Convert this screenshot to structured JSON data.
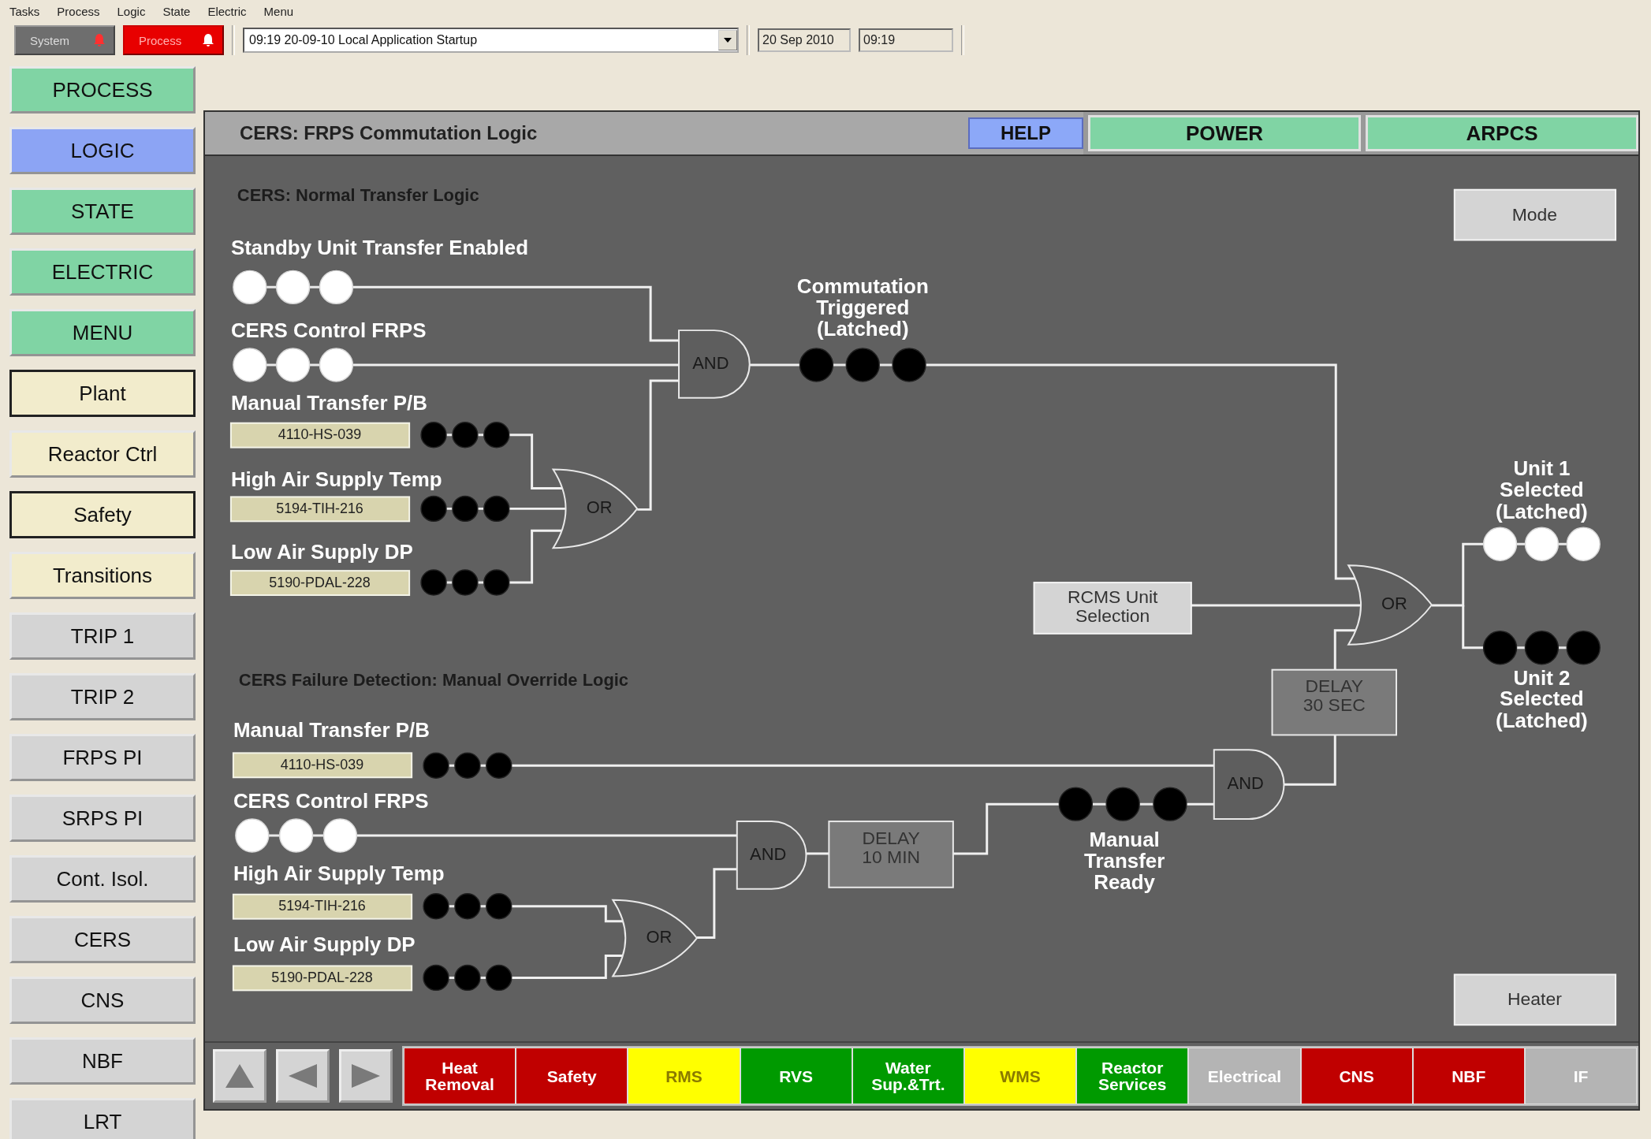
{
  "menu_bar": [
    "Tasks",
    "Process",
    "Logic",
    "State",
    "Electric",
    "Menu"
  ],
  "toolbar": {
    "alarm_buttons": [
      {
        "label": "System",
        "active": false
      },
      {
        "label": "Process",
        "active": true
      }
    ],
    "event_log": "09:19 20-09-10 Local Application Startup",
    "date": "20 Sep 2010",
    "time": "09:19"
  },
  "sidebar": [
    {
      "label": "PROCESS",
      "kind": "view",
      "selected": false
    },
    {
      "label": "LOGIC",
      "kind": "view",
      "selected": true
    },
    {
      "label": "STATE",
      "kind": "view",
      "selected": false
    },
    {
      "label": "ELECTRIC",
      "kind": "view",
      "selected": false
    },
    {
      "label": "MENU",
      "kind": "view",
      "selected": false
    },
    {
      "label": "Plant",
      "kind": "area",
      "selected": true
    },
    {
      "label": "Reactor Ctrl",
      "kind": "area",
      "selected": false
    },
    {
      "label": "Safety",
      "kind": "area",
      "selected": true
    },
    {
      "label": "Transitions",
      "kind": "area",
      "selected": false
    },
    {
      "label": "TRIP 1",
      "kind": "system",
      "selected": false
    },
    {
      "label": "TRIP 2",
      "kind": "system",
      "selected": false
    },
    {
      "label": "FRPS PI",
      "kind": "system",
      "selected": false
    },
    {
      "label": "SRPS PI",
      "kind": "system",
      "selected": false
    },
    {
      "label": "Cont. Isol.",
      "kind": "system",
      "selected": false
    },
    {
      "label": "CERS",
      "kind": "system",
      "selected": false
    },
    {
      "label": "CNS",
      "kind": "system",
      "selected": false
    },
    {
      "label": "NBF",
      "kind": "system",
      "selected": false
    },
    {
      "label": "LRT",
      "kind": "system",
      "selected": false
    }
  ],
  "header": {
    "title": "CERS: FRPS Commutation Logic",
    "help": "HELP",
    "tabs": [
      "POWER",
      "ARPCS"
    ]
  },
  "normal_transfer": {
    "title": "CERS: Normal Transfer Logic",
    "signals": [
      {
        "label": "Standby Unit Transfer Enabled",
        "on": true
      },
      {
        "label": "CERS Control FRPS",
        "on": true
      },
      {
        "label": "Manual Transfer P/B",
        "tag": "4110-HS-039",
        "on": false
      },
      {
        "label": "High Air Supply Temp",
        "tag": "5194-TIH-216",
        "on": false
      },
      {
        "label": "Low Air Supply DP",
        "tag": "5190-PDAL-228",
        "on": false
      }
    ],
    "gates": [
      {
        "kind": "and",
        "label": "AND"
      },
      {
        "kind": "or",
        "label": "OR"
      }
    ],
    "result": {
      "lines": [
        "Commutation",
        "Triggered",
        "(Latched)"
      ],
      "on": false
    }
  },
  "unit_selection": {
    "rcms": [
      "RCMS Unit",
      "Selection"
    ],
    "gate": {
      "kind": "or",
      "label": "OR"
    },
    "delay": [
      "DELAY",
      "30 SEC"
    ],
    "outputs": [
      {
        "lines": [
          "Unit 1",
          "Selected",
          "(Latched)"
        ],
        "on": true
      },
      {
        "lines": [
          "Unit 2",
          "Selected",
          "(Latched)"
        ],
        "on": false
      }
    ]
  },
  "manual_override": {
    "title": "CERS Failure Detection: Manual Override Logic",
    "signals": [
      {
        "label": "Manual Transfer P/B",
        "tag": "4110-HS-039",
        "on": false
      },
      {
        "label": "CERS Control FRPS",
        "on": true
      },
      {
        "label": "High Air Supply Temp",
        "tag": "5194-TIH-216",
        "on": false
      },
      {
        "label": "Low Air Supply DP",
        "tag": "5190-PDAL-228",
        "on": false
      }
    ],
    "gates": [
      {
        "kind": "and",
        "label": "AND"
      },
      {
        "kind": "or",
        "label": "OR"
      },
      {
        "kind": "and",
        "label": "AND"
      }
    ],
    "delay": [
      "DELAY",
      "10 MIN"
    ],
    "ready": {
      "lines": [
        "Manual",
        "Transfer",
        "Ready"
      ],
      "on": false
    }
  },
  "buttons": {
    "mode": "Mode",
    "heater": "Heater"
  },
  "system_tabs": [
    {
      "label": "Heat Removal",
      "color": "#c00000"
    },
    {
      "label": "Safety",
      "color": "#c00000"
    },
    {
      "label": "RMS",
      "color": "#ffff00"
    },
    {
      "label": "RVS",
      "color": "#009a00"
    },
    {
      "label": "Water Sup.&Trt.",
      "color": "#009a00"
    },
    {
      "label": "WMS",
      "color": "#ffff00"
    },
    {
      "label": "Reactor Services",
      "color": "#009a00"
    },
    {
      "label": "Electrical",
      "color": "#b4b4b4"
    },
    {
      "label": "CNS",
      "color": "#c00000"
    },
    {
      "label": "NBF",
      "color": "#c00000"
    },
    {
      "label": "IF",
      "color": "#b4b4b4"
    }
  ]
}
